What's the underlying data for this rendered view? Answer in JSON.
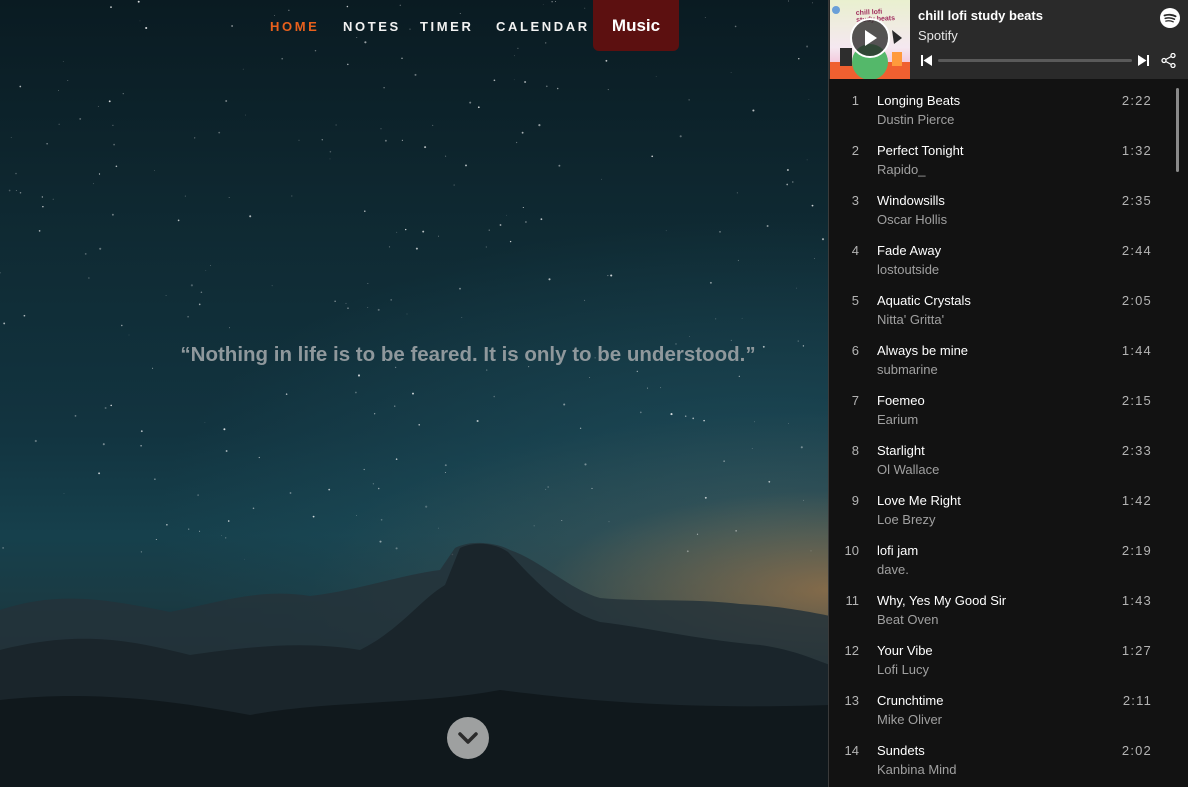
{
  "nav": {
    "items": [
      {
        "label": "HOME",
        "active": true
      },
      {
        "label": "NOTES",
        "active": false
      },
      {
        "label": "TIMER",
        "active": false
      },
      {
        "label": "CALENDAR",
        "active": false
      }
    ],
    "music_label": "Music",
    "accent_color": "#e8601c",
    "music_bg": "#5c1010"
  },
  "quote": "“Nothing in life is to be feared. It is only to be understood.”",
  "scroll_icon": "chevron-down-icon",
  "player": {
    "cover_text": "chill lofi study beats",
    "title": "chill lofi study beats",
    "subtitle": "Spotify",
    "progress": 0,
    "icons": [
      "play-icon",
      "spotify-icon",
      "previous-icon",
      "next-icon",
      "share-icon"
    ],
    "tracks": [
      {
        "num": "1",
        "name": "Longing Beats",
        "artist": "Dustin Pierce",
        "duration": "2:22"
      },
      {
        "num": "2",
        "name": "Perfect Tonight",
        "artist": "Rapido_",
        "duration": "1:32"
      },
      {
        "num": "3",
        "name": "Windowsills",
        "artist": "Oscar Hollis",
        "duration": "2:35"
      },
      {
        "num": "4",
        "name": "Fade Away",
        "artist": "lostoutside",
        "duration": "2:44"
      },
      {
        "num": "5",
        "name": "Aquatic Crystals",
        "artist": "Nitta' Gritta'",
        "duration": "2:05"
      },
      {
        "num": "6",
        "name": "Always be mine",
        "artist": "submarine",
        "duration": "1:44"
      },
      {
        "num": "7",
        "name": "Foemeo",
        "artist": "Earium",
        "duration": "2:15"
      },
      {
        "num": "8",
        "name": "Starlight",
        "artist": "Ol Wallace",
        "duration": "2:33"
      },
      {
        "num": "9",
        "name": "Love Me Right",
        "artist": "Loe Brezy",
        "duration": "1:42"
      },
      {
        "num": "10",
        "name": "lofi jam",
        "artist": "dave.",
        "duration": "2:19"
      },
      {
        "num": "11",
        "name": "Why, Yes My Good Sir",
        "artist": "Beat Oven",
        "duration": "1:43"
      },
      {
        "num": "12",
        "name": "Your Vibe",
        "artist": "Lofi Lucy",
        "duration": "1:27"
      },
      {
        "num": "13",
        "name": "Crunchtime",
        "artist": "Mike Oliver",
        "duration": "2:11"
      },
      {
        "num": "14",
        "name": "Sundets",
        "artist": "Kanbina Mind",
        "duration": "2:02"
      }
    ]
  }
}
